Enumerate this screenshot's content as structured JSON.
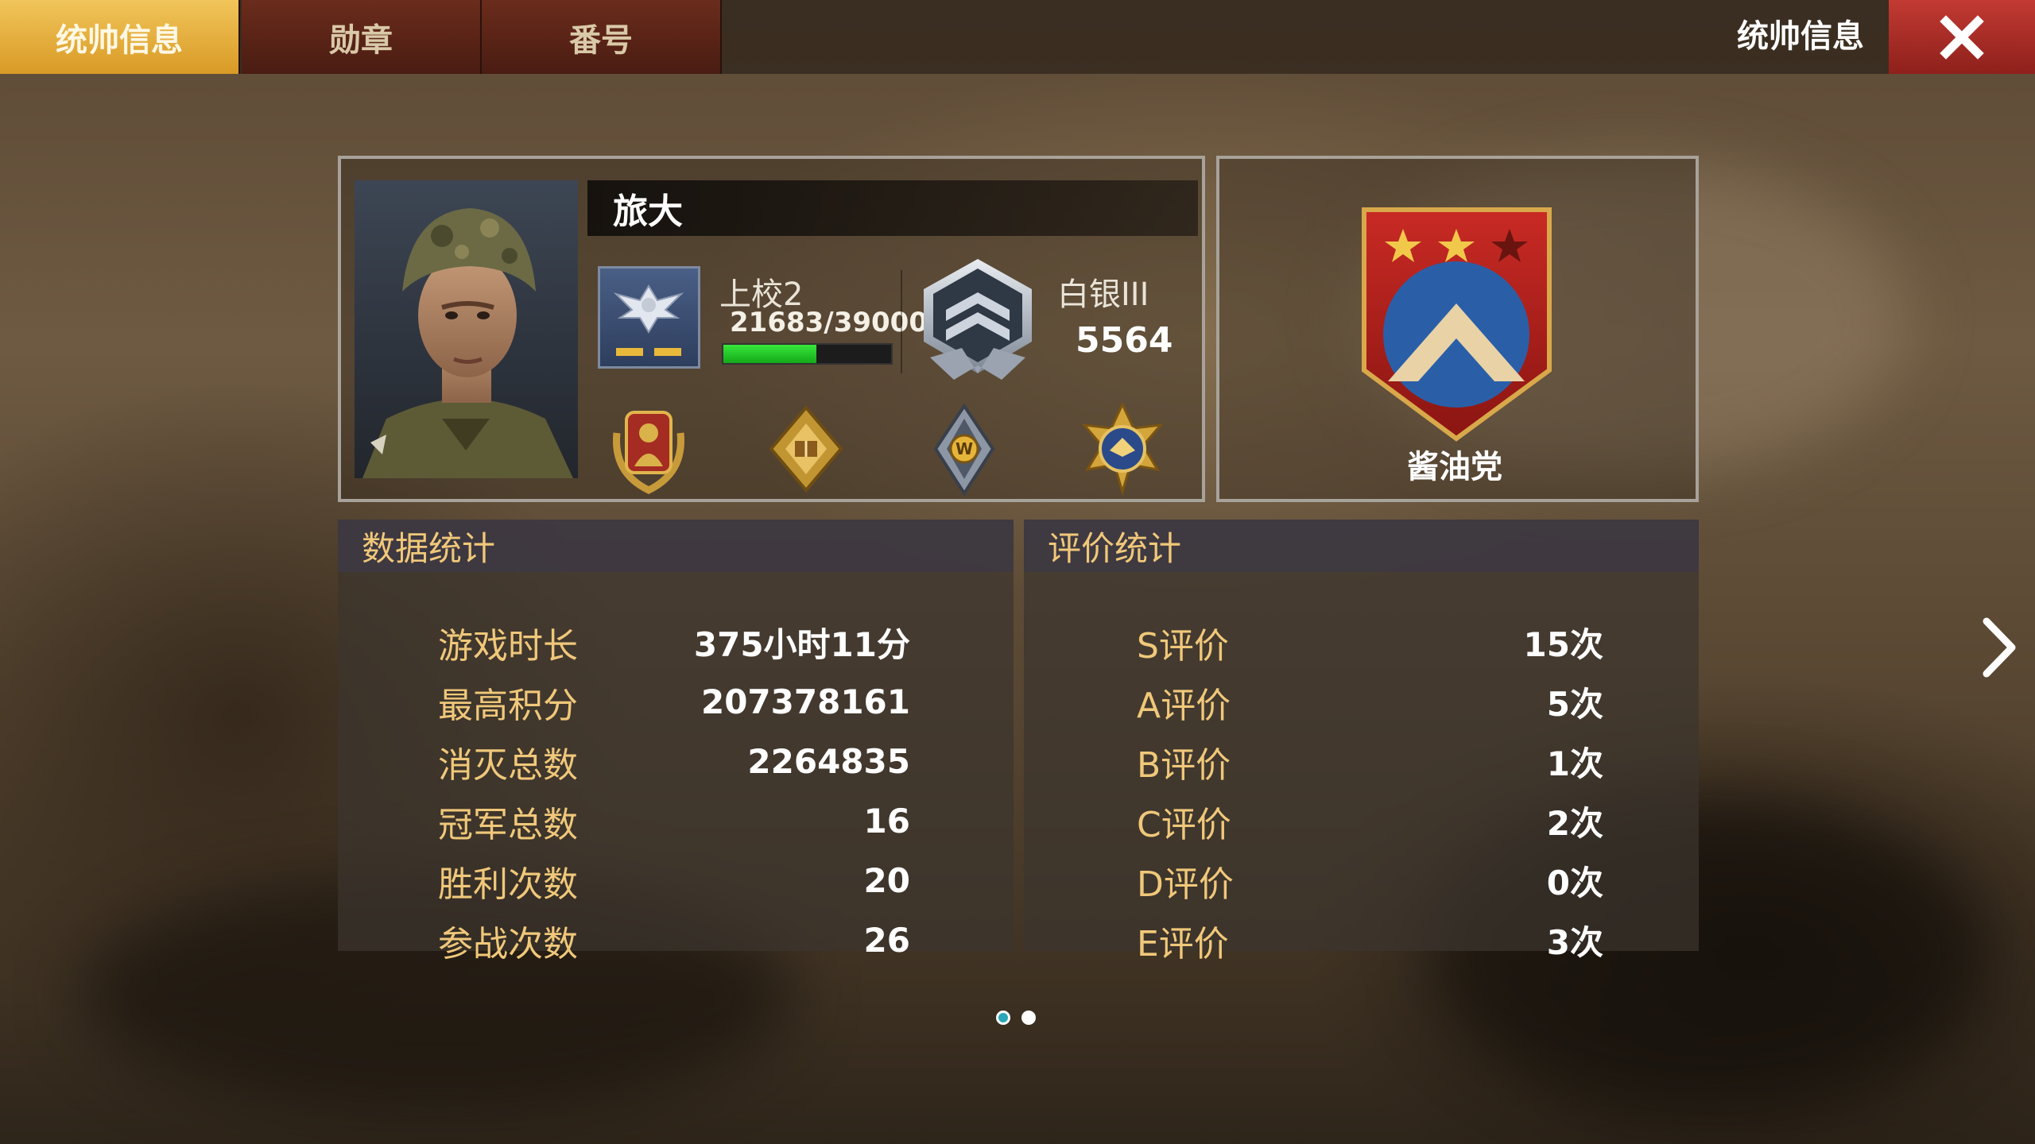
{
  "tabs": [
    {
      "label": "统帅信息",
      "active": true
    },
    {
      "label": "勋章",
      "active": false
    },
    {
      "label": "番号",
      "active": false
    }
  ],
  "header": {
    "title": "统帅信息",
    "close_icon": "close-x-icon"
  },
  "profile": {
    "name": "旅大",
    "rank": {
      "name": "上校2",
      "exp_text": "21683/39000",
      "exp_progress": 0.556
    },
    "league": {
      "name": "白银III",
      "score": "5564"
    },
    "medals": [
      "infantry-wreath-medal",
      "book-diamond-medal",
      "w-diamond-medal",
      "eagle-star-medal"
    ]
  },
  "clan": {
    "name": "酱油党"
  },
  "data_stats": {
    "title": "数据统计",
    "rows": [
      {
        "label": "游戏时长",
        "value": "375小时11分"
      },
      {
        "label": "最高积分",
        "value": "207378161"
      },
      {
        "label": "消灭总数",
        "value": "2264835"
      },
      {
        "label": "冠军总数",
        "value": "16"
      },
      {
        "label": "胜利次数",
        "value": "20"
      },
      {
        "label": "参战次数",
        "value": "26"
      }
    ]
  },
  "rating_stats": {
    "title": "评价统计",
    "rows": [
      {
        "label": "S评价",
        "value": "15次"
      },
      {
        "label": "A评价",
        "value": "5次"
      },
      {
        "label": "B评价",
        "value": "1次"
      },
      {
        "label": "C评价",
        "value": "2次"
      },
      {
        "label": "D评价",
        "value": "0次"
      },
      {
        "label": "E评价",
        "value": "3次"
      }
    ]
  },
  "pager": {
    "pages": 2,
    "current": 0
  },
  "colors": {
    "accent_gold": "#f0c87a",
    "tab_active": "#e4ad3c",
    "close_red": "#b02d27",
    "exp_green": "#22c42a"
  }
}
